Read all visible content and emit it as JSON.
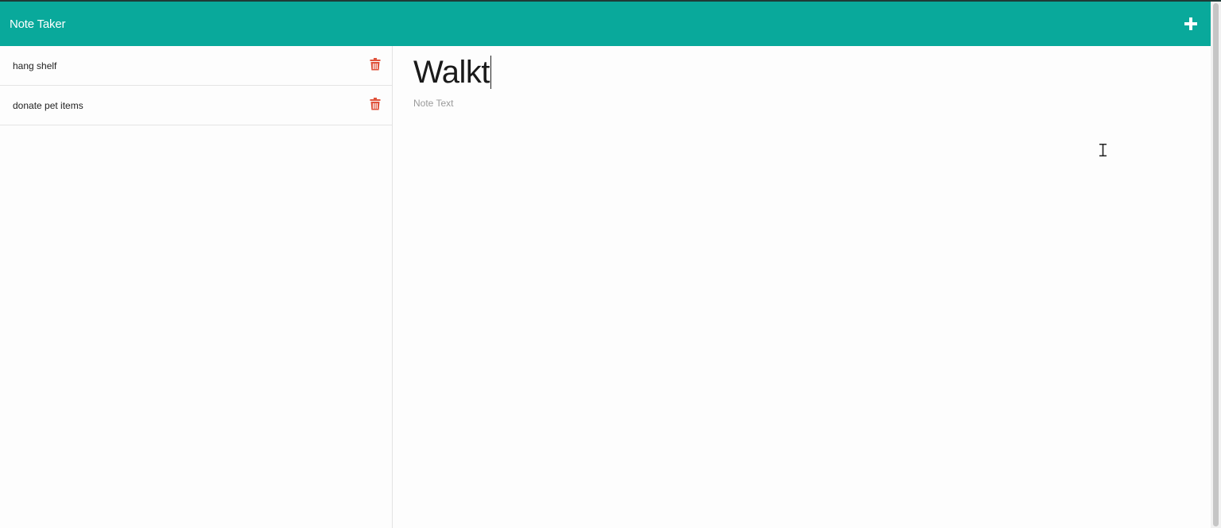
{
  "app": {
    "title": "Note Taker"
  },
  "navbar": {
    "new_note_icon": "plus-icon",
    "bg_color": "#09a99b"
  },
  "notes": [
    {
      "title": "hang shelf",
      "delete_icon": "trash-icon"
    },
    {
      "title": "donate pet items",
      "delete_icon": "trash-icon"
    }
  ],
  "editor": {
    "title_value": "Walkt",
    "text_placeholder": "Note Text"
  },
  "colors": {
    "accent": "#09a99b",
    "delete": "#e0533c"
  }
}
